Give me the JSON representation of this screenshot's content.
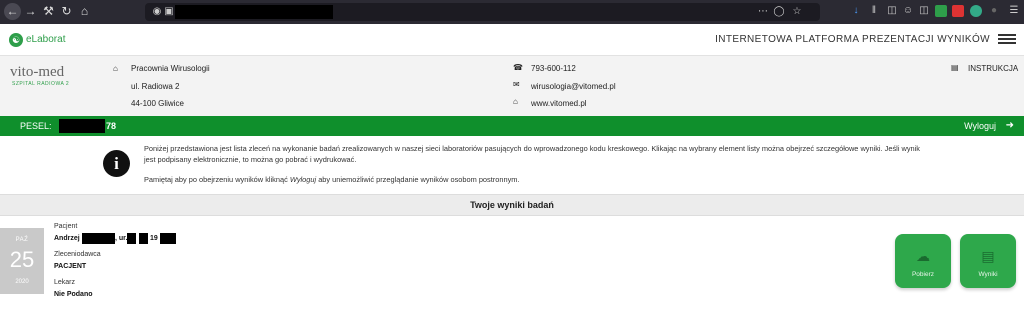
{
  "browser": {
    "back_icon": "arrow-left-icon",
    "toolbar_icons": [
      "forward-icon",
      "wrench-icon",
      "reload-icon",
      "home-icon"
    ]
  },
  "header": {
    "logo_text": "eLaborat",
    "title": "INTERNETOWA PLATFORMA PREZENTACJI WYNIKÓW"
  },
  "lab": {
    "logo_name": "vito-med",
    "logo_sub": "SZPITAL RADIOWA 2",
    "name": "Pracownia Wirusologii",
    "street": "ul. Radiowa 2",
    "city": "44-100 Gliwice",
    "phone": "793-600-112",
    "email": "wirusologia@vitomed.pl",
    "website": "www.vitomed.pl",
    "instruction": "INSTRUKCJA"
  },
  "session": {
    "pesel_label": "PESEL:",
    "pesel_suffix": "78",
    "logout": "Wyloguj"
  },
  "notice": {
    "text1": "Poniżej przedstawiona jest lista zleceń na wykonanie badań zrealizowanych w naszej sieci laboratoriów pasujących do wprowadzonego kodu kreskowego. Klikając na wybrany element listy można obejrzeć szczegółowe wyniki. Jeśli wynik jest podpisany elektronicznie, to można go pobrać i wydrukować.",
    "text2_pre": "Pamiętaj aby po obejrzeniu wyników kliknąć ",
    "text2_em": "Wyloguj",
    "text2_post": " aby uniemożliwić przeglądanie wyników osobom postronnym."
  },
  "results": {
    "heading": "Twoje wyniki badań",
    "items": [
      {
        "month": "PAŹ",
        "day": "25",
        "year": "2020",
        "patient_label": "Pacjent",
        "patient_first": "Andrzej",
        "patient_mid": ", ur. ",
        "patient_year_prefix": "19",
        "orderer_label": "Zleceniodawca",
        "orderer": "PACJENT",
        "doctor_label": "Lekarz",
        "doctor": "Nie Podano",
        "download": "Pobierz",
        "results_btn": "Wyniki"
      }
    ]
  }
}
